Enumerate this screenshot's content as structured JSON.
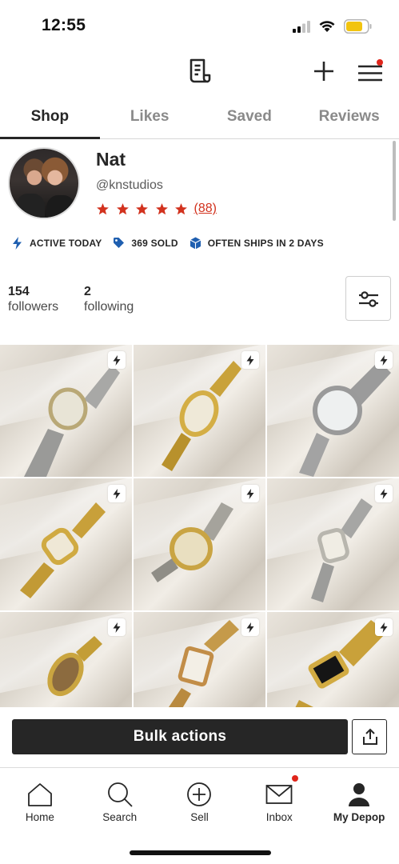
{
  "status_bar": {
    "time": "12:55",
    "icons": [
      "signal-icon",
      "wifi-icon",
      "battery-icon"
    ],
    "battery_color": "#f2c40f"
  },
  "top_bar": {
    "icons": [
      "receipt-icon",
      "plus-icon",
      "menu-icon"
    ],
    "notification_dot_color": "#e0251b"
  },
  "tabs": [
    {
      "label": "Shop",
      "active": true
    },
    {
      "label": "Likes",
      "active": false
    },
    {
      "label": "Saved",
      "active": false
    },
    {
      "label": "Reviews",
      "active": false
    }
  ],
  "profile": {
    "name": "Nat",
    "handle": "@knstudios",
    "stars": 5,
    "review_count": "(88)",
    "star_color": "#d2321e"
  },
  "badges": [
    {
      "icon": "lightning-icon",
      "label": "ACTIVE TODAY"
    },
    {
      "icon": "tag-icon",
      "label": "369 SOLD"
    },
    {
      "icon": "box-icon",
      "label": "OFTEN SHIPS IN 2 DAYS"
    }
  ],
  "badge_color": "#1f5fb0",
  "stats": {
    "followers_count": "154",
    "followers_label": "followers",
    "following_count": "2",
    "following_label": "following"
  },
  "filter_icon": "sliders-icon",
  "listings": [
    {
      "item": "silver-two-tone watch",
      "boosted": true
    },
    {
      "item": "gold oval watch",
      "boosted": true
    },
    {
      "item": "silver round watch",
      "boosted": true
    },
    {
      "item": "gold cushion watch",
      "boosted": true
    },
    {
      "item": "two-tone round watch",
      "boosted": true
    },
    {
      "item": "silver tonneau watch",
      "boosted": true
    },
    {
      "item": "gold oval textured watch",
      "boosted": true
    },
    {
      "item": "rose-gold rectangular watch",
      "boosted": true
    },
    {
      "item": "gold black-dial watch",
      "boosted": true
    }
  ],
  "bulk": {
    "button_label": "Bulk actions",
    "share_icon": "share-icon"
  },
  "bottom_nav": [
    {
      "label": "Home",
      "icon": "home-icon",
      "active": false
    },
    {
      "label": "Search",
      "icon": "search-icon",
      "active": false
    },
    {
      "label": "Sell",
      "icon": "sell-plus-icon",
      "active": false
    },
    {
      "label": "Inbox",
      "icon": "inbox-icon",
      "active": false,
      "badge_dot": true
    },
    {
      "label": "My Depop",
      "icon": "profile-icon",
      "active": true
    }
  ]
}
